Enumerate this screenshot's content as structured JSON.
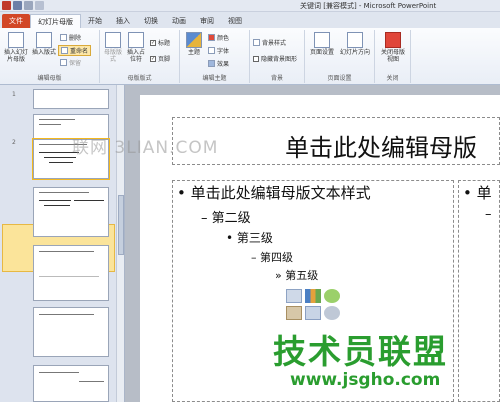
{
  "window": {
    "title": "关键词 [兼容模式] - Microsoft PowerPoint"
  },
  "tabs": [
    {
      "label": "文件"
    },
    {
      "label": "幻灯片母版"
    },
    {
      "label": "开始"
    },
    {
      "label": "插入"
    },
    {
      "label": "切换"
    },
    {
      "label": "动画"
    },
    {
      "label": "审阅"
    },
    {
      "label": "视图"
    }
  ],
  "ribbon": {
    "edit_master": {
      "label": "编辑母版",
      "insert_slide_master": "插入幻灯片母版",
      "insert_layout": "插入版式",
      "delete": "删除",
      "rename": "重命名",
      "preserve": "保留"
    },
    "master_layout": {
      "label": "母版版式",
      "master_layout_btn": "母版版式",
      "insert_placeholder": "插入占位符",
      "title_check": "标题",
      "footer_check": "页脚"
    },
    "edit_theme": {
      "label": "编辑主题",
      "themes": "主题",
      "colors": "颜色",
      "fonts": "字体",
      "effects": "效果"
    },
    "background": {
      "label": "背景",
      "bg_styles": "背景样式",
      "hide_bg": "隐藏背景图形"
    },
    "page_setup": {
      "label": "页面设置",
      "page_setup_btn": "页面设置",
      "orientation": "幻灯片方向"
    },
    "close": {
      "label": "关闭",
      "close_master": "关闭母版视图"
    }
  },
  "thumbnails": {
    "numbers": [
      "1",
      "2"
    ]
  },
  "slide": {
    "title": "单击此处编辑母版",
    "level1": "单击此处编辑母版文本样式",
    "level2": "第二级",
    "level3": "第三级",
    "level4": "第四级",
    "level5": "第五级",
    "right_bullet": "单",
    "right_dash": "–"
  },
  "watermarks": {
    "top": "联网 3LIAN.COM",
    "main": "技术员联盟",
    "url": "www.jsgho.com"
  },
  "colors": {
    "file_tab": "#d24726",
    "selection": "#fbe49a",
    "watermark_green": "#2a9d2f"
  }
}
